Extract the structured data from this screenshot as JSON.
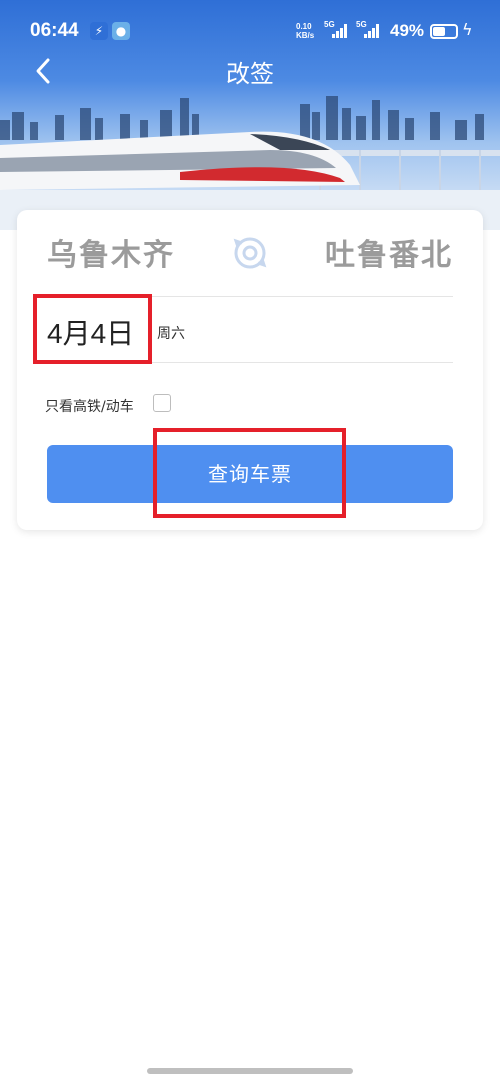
{
  "status_bar": {
    "time": "06:44",
    "network_speed_value": "0.10",
    "network_speed_unit": "KB/s",
    "signal1": "5G",
    "signal2": "5G",
    "battery_percent": "49%"
  },
  "header": {
    "title": "改签",
    "back_icon": "chevron-left-icon"
  },
  "card": {
    "from_station": "乌鲁木齐",
    "to_station": "吐鲁番北",
    "swap_icon": "swap-stations-icon",
    "date": "4月4日",
    "weekday": "周六",
    "filter_label": "只看高铁/动车",
    "filter_checked": false,
    "search_button": "查询车票"
  },
  "colors": {
    "accent": "#4f8ff0",
    "highlight": "#e5202a",
    "station_text": "#9b9b9b"
  }
}
